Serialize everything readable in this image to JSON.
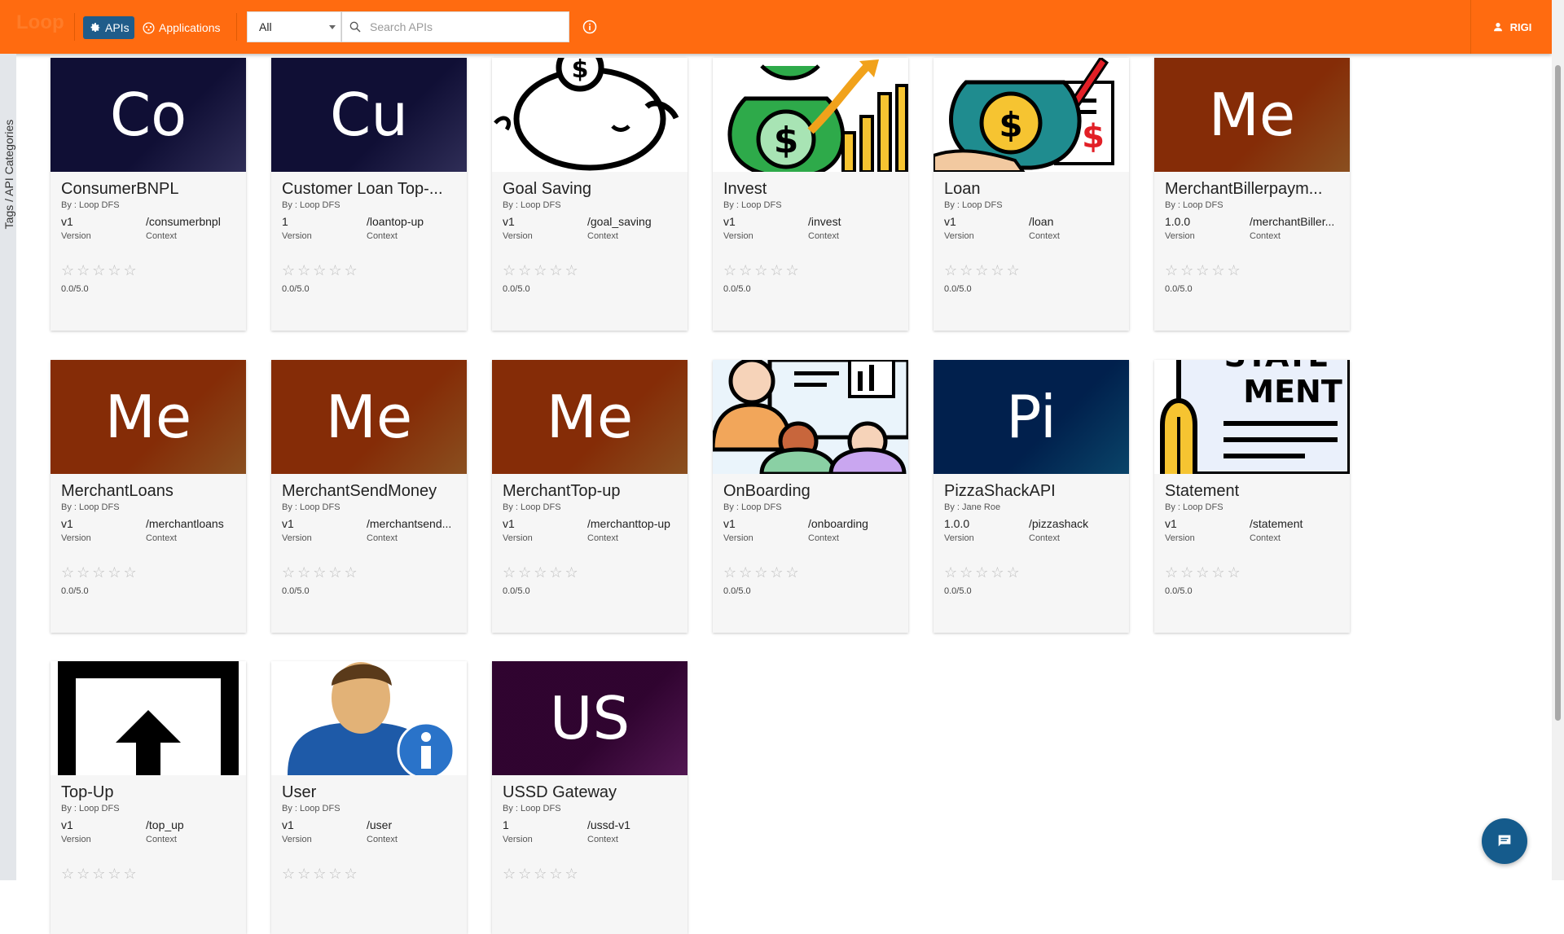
{
  "topbar": {
    "logo_text": "Loop",
    "nav": [
      {
        "label": "APIs",
        "active": true,
        "icon": "gear-icon"
      },
      {
        "label": "Applications",
        "active": false,
        "icon": "applications-icon"
      }
    ],
    "filter": {
      "selected": "All"
    },
    "search": {
      "placeholder": "Search APIs",
      "value": ""
    },
    "user": {
      "name": "RIGI"
    }
  },
  "sidebar": {
    "tab_label": "Tags / API Categories"
  },
  "cards": [
    {
      "thumb_type": "initials",
      "initials": "Co",
      "thumb_color": "#3f3d74",
      "title": "ConsumerBNPL",
      "by": "By : Loop DFS",
      "version": "v1",
      "context": "/consumerbnpl",
      "version_label": "Version",
      "context_label": "Context",
      "rating": "0.0/5.0"
    },
    {
      "thumb_type": "initials",
      "initials": "Cu",
      "thumb_color": "#3f3d74",
      "title": "Customer Loan Top-...",
      "by": "By : Loop DFS",
      "version": "1",
      "context": "/loantop-up",
      "version_label": "Version",
      "context_label": "Context",
      "rating": "0.0/5.0"
    },
    {
      "thumb_type": "image",
      "image": "piggy-bank-icon",
      "title": "Goal Saving",
      "by": "By : Loop DFS",
      "version": "v1",
      "context": "/goal_saving",
      "version_label": "Version",
      "context_label": "Context",
      "rating": "0.0/5.0"
    },
    {
      "thumb_type": "image",
      "image": "money-bag-growth-icon",
      "title": "Invest",
      "by": "By : Loop DFS",
      "version": "v1",
      "context": "/invest",
      "version_label": "Version",
      "context_label": "Context",
      "rating": "0.0/5.0"
    },
    {
      "thumb_type": "image",
      "image": "loan-money-bag-icon",
      "title": "Loan",
      "by": "By : Loop DFS",
      "version": "v1",
      "context": "/loan",
      "version_label": "Version",
      "context_label": "Context",
      "rating": "0.0/5.0"
    },
    {
      "thumb_type": "initials",
      "initials": "Me",
      "thumb_color": "#b86a2a",
      "title": "MerchantBillerpaym...",
      "by": "By : Loop DFS",
      "version": "1.0.0",
      "context": "/merchantBiller...",
      "version_label": "Version",
      "context_label": "Context",
      "rating": "0.0/5.0"
    },
    {
      "thumb_type": "initials",
      "initials": "Me",
      "thumb_color": "#b86a2a",
      "title": "MerchantLoans",
      "by": "By : Loop DFS",
      "version": "v1",
      "context": "/merchantloans",
      "version_label": "Version",
      "context_label": "Context",
      "rating": "0.0/5.0"
    },
    {
      "thumb_type": "initials",
      "initials": "Me",
      "thumb_color": "#b86a2a",
      "title": "MerchantSendMoney",
      "by": "By : Loop DFS",
      "version": "v1",
      "context": "/merchantsend...",
      "version_label": "Version",
      "context_label": "Context",
      "rating": "0.0/5.0"
    },
    {
      "thumb_type": "initials",
      "initials": "Me",
      "thumb_color": "#b86a2a",
      "title": "MerchantTop-up",
      "by": "By : Loop DFS",
      "version": "v1",
      "context": "/merchanttop-up",
      "version_label": "Version",
      "context_label": "Context",
      "rating": "0.0/5.0"
    },
    {
      "thumb_type": "image",
      "image": "onboarding-meeting-icon",
      "title": "OnBoarding",
      "by": "By : Loop DFS",
      "version": "v1",
      "context": "/onboarding",
      "version_label": "Version",
      "context_label": "Context",
      "rating": "0.0/5.0"
    },
    {
      "thumb_type": "initials",
      "initials": "Pi",
      "thumb_color": "#0d5b8c",
      "title": "PizzaShackAPI",
      "by": "By : Jane Roe",
      "version": "1.0.0",
      "context": "/pizzashack",
      "version_label": "Version",
      "context_label": "Context",
      "rating": "0.0/5.0"
    },
    {
      "thumb_type": "image",
      "image": "statement-document-icon",
      "image_text": "STATE MENT",
      "title": "Statement",
      "by": "By : Loop DFS",
      "version": "v1",
      "context": "/statement",
      "version_label": "Version",
      "context_label": "Context",
      "rating": "0.0/5.0"
    },
    {
      "thumb_type": "image",
      "image": "upload-arrow-icon",
      "title": "Top-Up",
      "by": "By : Loop DFS",
      "version": "v1",
      "context": "/top_up",
      "version_label": "Version",
      "context_label": "Context",
      "rating": ""
    },
    {
      "thumb_type": "image",
      "image": "user-info-icon",
      "title": "User",
      "by": "By : Loop DFS",
      "version": "v1",
      "context": "/user",
      "version_label": "Version",
      "context_label": "Context",
      "rating": ""
    },
    {
      "thumb_type": "initials",
      "initials": "US",
      "thumb_color": "#6e1f6e",
      "title": "USSD Gateway",
      "by": "By : Loop DFS",
      "version": "1",
      "context": "/ussd-v1",
      "version_label": "Version",
      "context_label": "Context",
      "rating": ""
    }
  ],
  "colors": {
    "topbar": "#ff6b10",
    "active_nav": "#1f5c8a",
    "fab": "#155b8c",
    "card_bg": "#f6f6f6"
  },
  "fab": {
    "icon": "chat-icon"
  }
}
